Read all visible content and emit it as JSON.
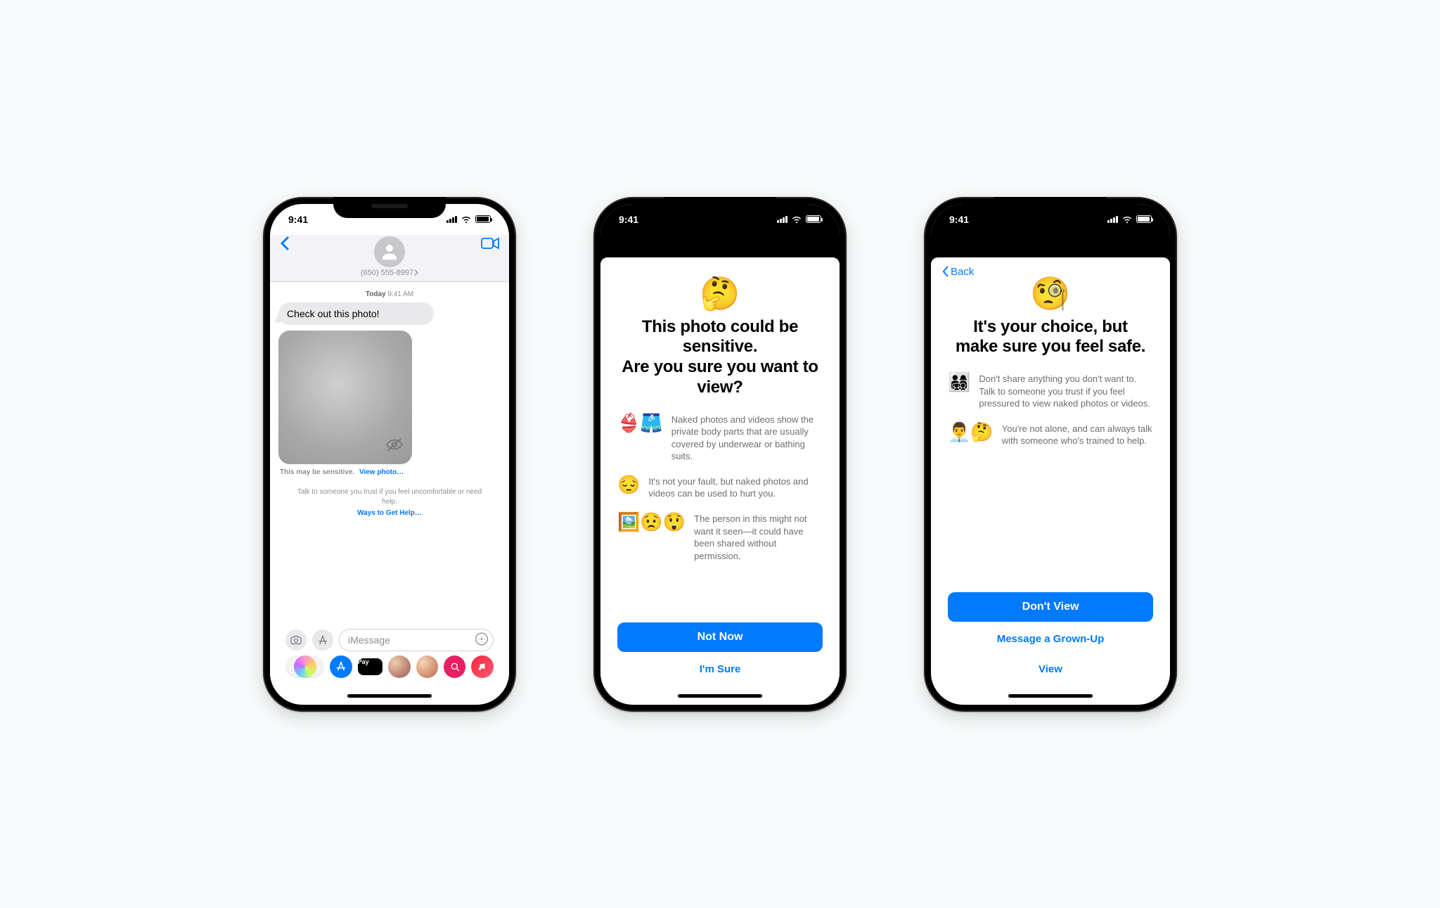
{
  "status_time": "9:41",
  "phone1": {
    "contact": "(650) 555-8997",
    "day_label": "Today",
    "time_label": "9:41 AM",
    "message": "Check out this photo!",
    "caption_lead": "This may be sensitive.",
    "caption_link": "View photo…",
    "help_text": "Talk to someone you trust if you feel uncomfortable or need help.",
    "help_link": "Ways to Get Help…",
    "placeholder": "iMessage"
  },
  "phone2": {
    "title": "This photo could be sensitive.\nAre you sure you want to view?",
    "points": [
      {
        "icon": "👙🩳",
        "text": "Naked photos and videos show the private body parts that are usually covered by underwear or bathing suits."
      },
      {
        "icon": "😔",
        "text": "It's not your fault, but naked photos and videos can be used to hurt you."
      },
      {
        "icon": "🖼️😟😲",
        "text": "The person in this might not want it seen—it could have been shared without permission."
      }
    ],
    "primary": "Not Now",
    "secondary": "I'm Sure"
  },
  "phone3": {
    "back": "Back",
    "title": "It's your choice, but make sure you feel safe.",
    "points": [
      {
        "icon": "👨‍👩‍👧‍👦",
        "text": "Don't share anything you don't want to. Talk to someone you trust if you feel pressured to view naked photos or videos."
      },
      {
        "icon": "👨‍💼🤔",
        "text": "You're not alone, and can always talk with someone who's trained to help."
      }
    ],
    "primary": "Don't View",
    "secondary": "Message a Grown-Up",
    "tertiary": "View"
  }
}
